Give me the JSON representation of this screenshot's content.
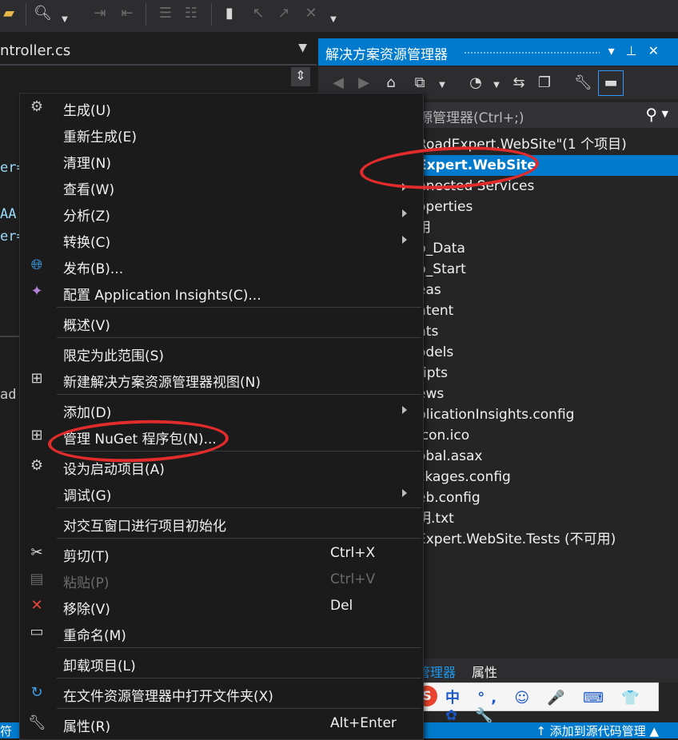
{
  "editor": {
    "tab_title": "ntroller.cs",
    "code_fragments": [
      "er=",
      "AA(",
      "er=",
      "ad("
    ]
  },
  "solution_explorer": {
    "title": "解决方案资源管理器",
    "search_placeholder": "源管理器(Ctrl+;)",
    "tree": [
      "RoadExpert.WebSite\"(1 个项目)",
      "Expert.WebSite",
      "nnected Services",
      "operties",
      "用",
      "p_Data",
      "p_Start",
      "eas",
      "ntent",
      "nts",
      "odels",
      "ripts",
      "ews",
      "plicationInsights.config",
      "icon.ico",
      "obal.asax",
      "ckages.config",
      "eb.config",
      "明.txt",
      "Expert.WebSite.Tests (不可用)"
    ],
    "selected_index": 1,
    "bottom_tabs": [
      "管理器",
      "属性"
    ],
    "ime_text": "中 °, ☺ 🎤 ⌨ 👕 ✿ 🔧"
  },
  "context_menu": {
    "items": [
      {
        "label": "生成(U)",
        "icon": "build-icon",
        "arrow": false,
        "shortcut": ""
      },
      {
        "label": "重新生成(E)",
        "icon": "",
        "arrow": false,
        "shortcut": ""
      },
      {
        "label": "清理(N)",
        "icon": "",
        "arrow": false,
        "shortcut": ""
      },
      {
        "label": "查看(W)",
        "icon": "",
        "arrow": true,
        "shortcut": ""
      },
      {
        "label": "分析(Z)",
        "icon": "",
        "arrow": true,
        "shortcut": ""
      },
      {
        "label": "转换(C)",
        "icon": "",
        "arrow": true,
        "shortcut": ""
      },
      {
        "label": "发布(B)...",
        "icon": "globe-icon",
        "arrow": false,
        "shortcut": ""
      },
      {
        "label": "配置 Application Insights(C)...",
        "icon": "lightbulb-icon",
        "arrow": false,
        "shortcut": ""
      },
      {
        "label": "概述(V)",
        "icon": "",
        "arrow": false,
        "shortcut": ""
      },
      {
        "label": "限定为此范围(S)",
        "icon": "",
        "arrow": false,
        "shortcut": ""
      },
      {
        "label": "新建解决方案资源管理器视图(N)",
        "icon": "new-view-icon",
        "arrow": false,
        "shortcut": ""
      },
      {
        "label": "添加(D)",
        "icon": "",
        "arrow": true,
        "shortcut": ""
      },
      {
        "label": "管理 NuGet 程序包(N)...",
        "icon": "package-icon",
        "arrow": false,
        "shortcut": ""
      },
      {
        "label": "设为启动项目(A)",
        "icon": "gear-icon",
        "arrow": false,
        "shortcut": ""
      },
      {
        "label": "调试(G)",
        "icon": "",
        "arrow": true,
        "shortcut": ""
      },
      {
        "label": "对交互窗口进行项目初始化",
        "icon": "",
        "arrow": false,
        "shortcut": ""
      },
      {
        "label": "剪切(T)",
        "icon": "scissors-icon",
        "arrow": false,
        "shortcut": "Ctrl+X"
      },
      {
        "label": "粘贴(P)",
        "icon": "clipboard-icon",
        "arrow": false,
        "shortcut": "Ctrl+V",
        "disabled": true
      },
      {
        "label": "移除(V)",
        "icon": "remove-icon",
        "arrow": false,
        "shortcut": "Del"
      },
      {
        "label": "重命名(M)",
        "icon": "rename-icon",
        "arrow": false,
        "shortcut": ""
      },
      {
        "label": "卸载项目(L)",
        "icon": "",
        "arrow": false,
        "shortcut": ""
      },
      {
        "label": "在文件资源管理器中打开文件夹(X)",
        "icon": "refresh-icon",
        "arrow": false,
        "shortcut": ""
      },
      {
        "label": "属性(R)",
        "icon": "wrench-icon",
        "arrow": false,
        "shortcut": "Alt+Enter"
      }
    ]
  },
  "status_bar": {
    "left_text": "符",
    "right_text": "↑ 添加到源代码管理 ▲"
  },
  "colors": {
    "accent": "#007acc",
    "annotation": "#e22b2b"
  }
}
